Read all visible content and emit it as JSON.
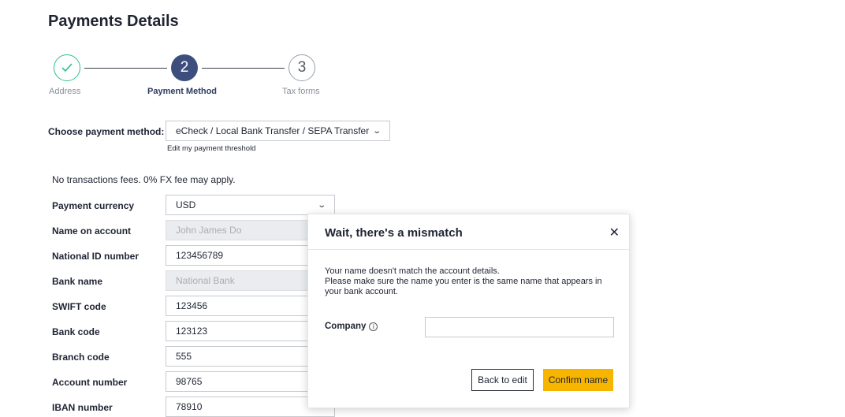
{
  "page": {
    "title": "Payments Details"
  },
  "stepper": {
    "steps": [
      {
        "number": "✓",
        "label": "Address",
        "state": "completed"
      },
      {
        "number": "2",
        "label": "Payment Method",
        "state": "active"
      },
      {
        "number": "3",
        "label": "Tax forms",
        "state": "upcoming"
      }
    ]
  },
  "payment_method": {
    "label": "Choose payment method:",
    "selected": "eCheck / Local Bank Transfer / SEPA Transfer",
    "threshold_link": "Edit my payment threshold"
  },
  "fees_note": "No transactions fees. 0% FX fee may apply.",
  "form": {
    "currency": {
      "label": "Payment currency",
      "value": "USD"
    },
    "name_on_account": {
      "label": "Name on account",
      "value": "John James Do"
    },
    "national_id": {
      "label": "National ID number",
      "value": "123456789"
    },
    "bank_name": {
      "label": "Bank name",
      "value": "National Bank"
    },
    "swift": {
      "label": "SWIFT code",
      "value": "123456"
    },
    "bank_code": {
      "label": "Bank code",
      "value": "123123"
    },
    "branch_code": {
      "label": "Branch code",
      "value": "555"
    },
    "account_number": {
      "label": "Account number",
      "value": "98765"
    },
    "iban": {
      "label": "IBAN number",
      "value": "78910"
    }
  },
  "modal": {
    "title": "Wait, there's a mismatch",
    "message_line1": "Your name doesn't match the account details.",
    "message_line2": "Please make sure the name you enter is the same name that appears in your bank account.",
    "company_label": "Company",
    "company_value": "",
    "back_label": "Back to edit",
    "confirm_label": "Confirm name"
  },
  "colors": {
    "accent_yellow": "#f7b500",
    "step_active": "#3d4e7e",
    "step_done": "#2bbf8b"
  }
}
